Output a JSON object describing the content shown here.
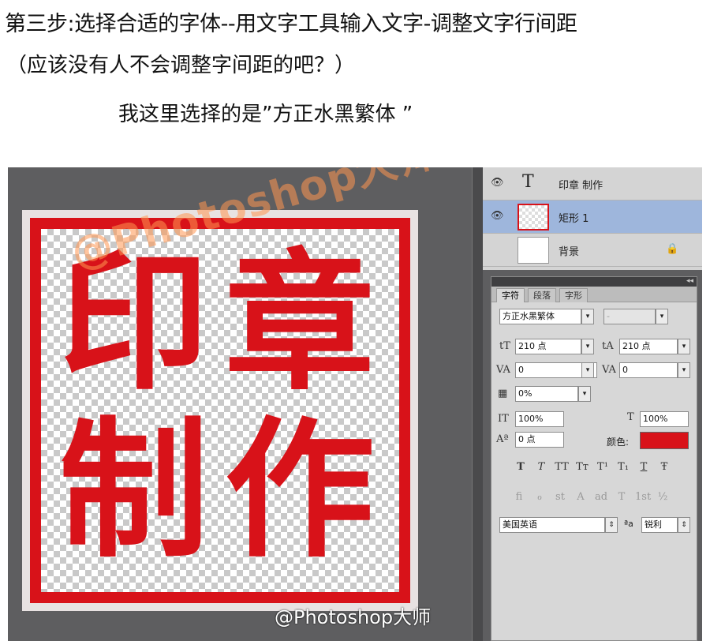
{
  "captions": {
    "line1": "第三步:选择合适的字体--用文字工具输入文字-调整文字行间距",
    "line2": "（应该没有人不会调整字间距的吧？）",
    "line3": "我这里选择的是”方正水黑繁体 ”"
  },
  "canvas": {
    "chars": [
      "印",
      "章",
      "制",
      "作"
    ],
    "stamp_color": "#d81219",
    "watermark_top": "@Photoshop大师",
    "watermark_bottom": "@Photoshop大师"
  },
  "layers": [
    {
      "name": "印章 制作",
      "type": "text"
    },
    {
      "name": "矩形 1",
      "type": "shape",
      "selected": true
    },
    {
      "name": "背景",
      "type": "background",
      "locked": true
    }
  ],
  "character_panel": {
    "tabs": [
      "字符",
      "段落",
      "字形"
    ],
    "font_family": "方正水黑繁体",
    "font_style": "-",
    "font_size": "210 点",
    "leading": "210 点",
    "kerning": "0",
    "tracking": "0",
    "scale_percent": "0%",
    "vertical_scale": "100%",
    "horizontal_scale": "100%",
    "baseline_shift": "0 点",
    "color_label": "颜色:",
    "color_value": "#d81219",
    "language": "美国英语",
    "aa_label": "ªa",
    "antialias": "锐利",
    "style_buttons": [
      "T",
      "T",
      "TT",
      "Tт",
      "T¹",
      "T₁",
      "T",
      "Ŧ"
    ],
    "opentype_buttons": [
      "fi",
      "ℴ",
      "st",
      "A",
      "ad",
      "T",
      "1st",
      "½"
    ]
  }
}
